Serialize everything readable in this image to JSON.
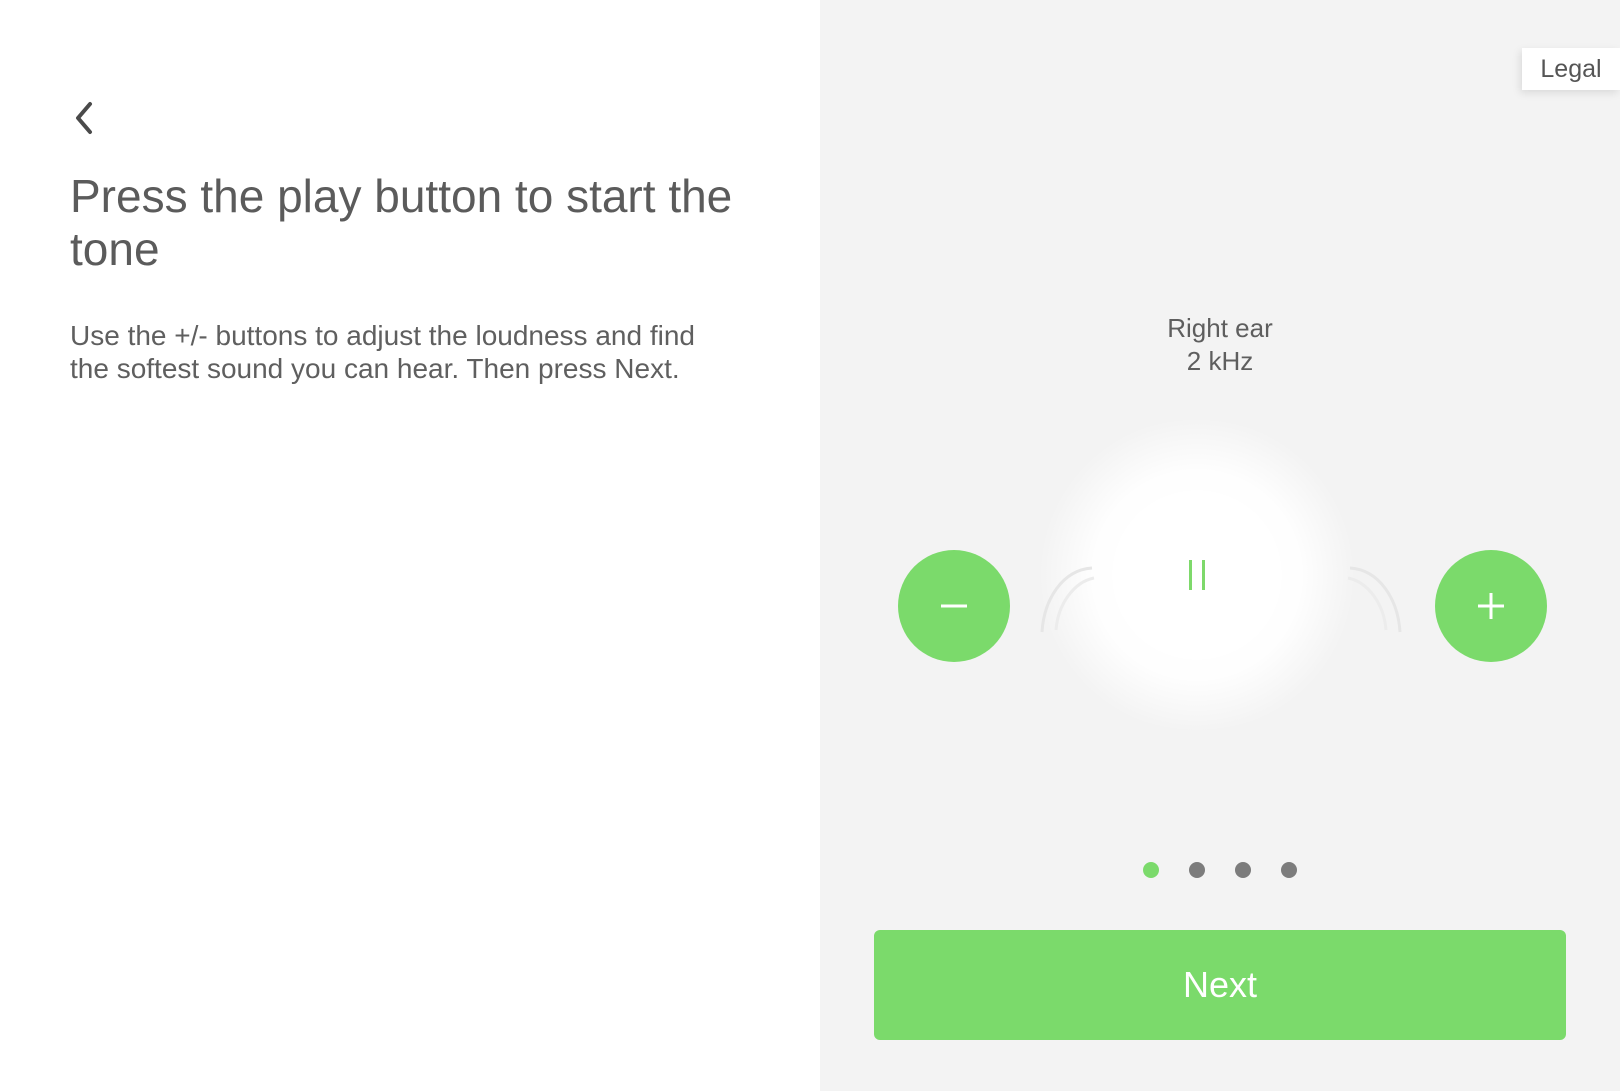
{
  "left": {
    "title": "Press the play button to start the tone",
    "instructions": "Use the +/- buttons to adjust the loudness and find the softest sound you can hear. Then press Next."
  },
  "right": {
    "legal_label": "Legal",
    "ear_label": "Right ear",
    "frequency_label": "2 kHz",
    "player_state": "playing",
    "pagination": {
      "total": 4,
      "current": 1
    },
    "next_label": "Next"
  },
  "colors": {
    "accent": "#7bda6b",
    "right_panel_bg": "#f3f3f3",
    "text": "#5b5b5b",
    "inactive_dot": "#7c7c7c"
  },
  "icons": {
    "back": "chevron-left-icon",
    "minus": "minus-icon",
    "plus": "plus-icon",
    "pause": "pause-icon",
    "sound_wave": "sound-wave-icon"
  }
}
